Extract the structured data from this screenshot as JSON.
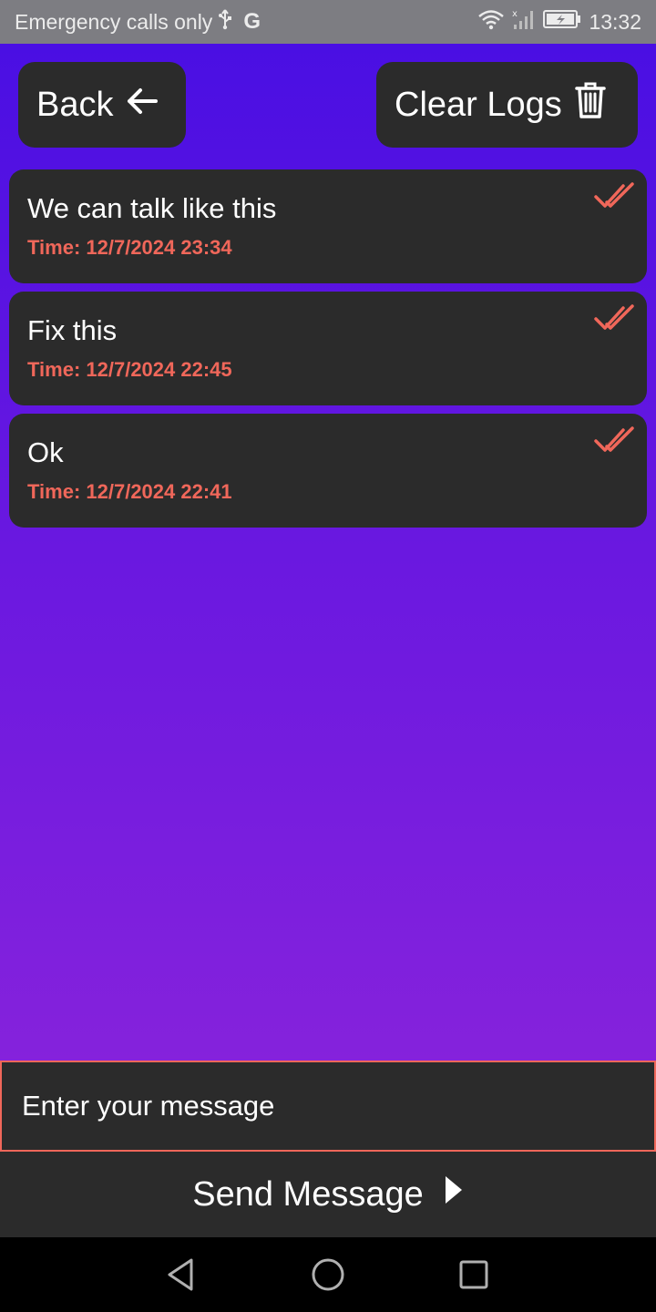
{
  "status_bar": {
    "carrier_text": "Emergency calls only",
    "usb_icon": "usb-icon",
    "google_g": "G",
    "time": "13:32"
  },
  "toolbar": {
    "back_label": "Back",
    "clear_label": "Clear Logs"
  },
  "messages": [
    {
      "text": "We can talk like this",
      "time": "Time: 12/7/2024 23:34"
    },
    {
      "text": "Fix this",
      "time": "Time: 12/7/2024 22:45"
    },
    {
      "text": "Ok",
      "time": "Time: 12/7/2024 22:41"
    }
  ],
  "composer": {
    "placeholder": "Enter your message",
    "send_label": "Send Message"
  },
  "colors": {
    "accent": "#f0675a",
    "card_bg": "#2b2b2b",
    "gradient_top": "#4a0fe3",
    "gradient_bottom": "#8522dc"
  }
}
